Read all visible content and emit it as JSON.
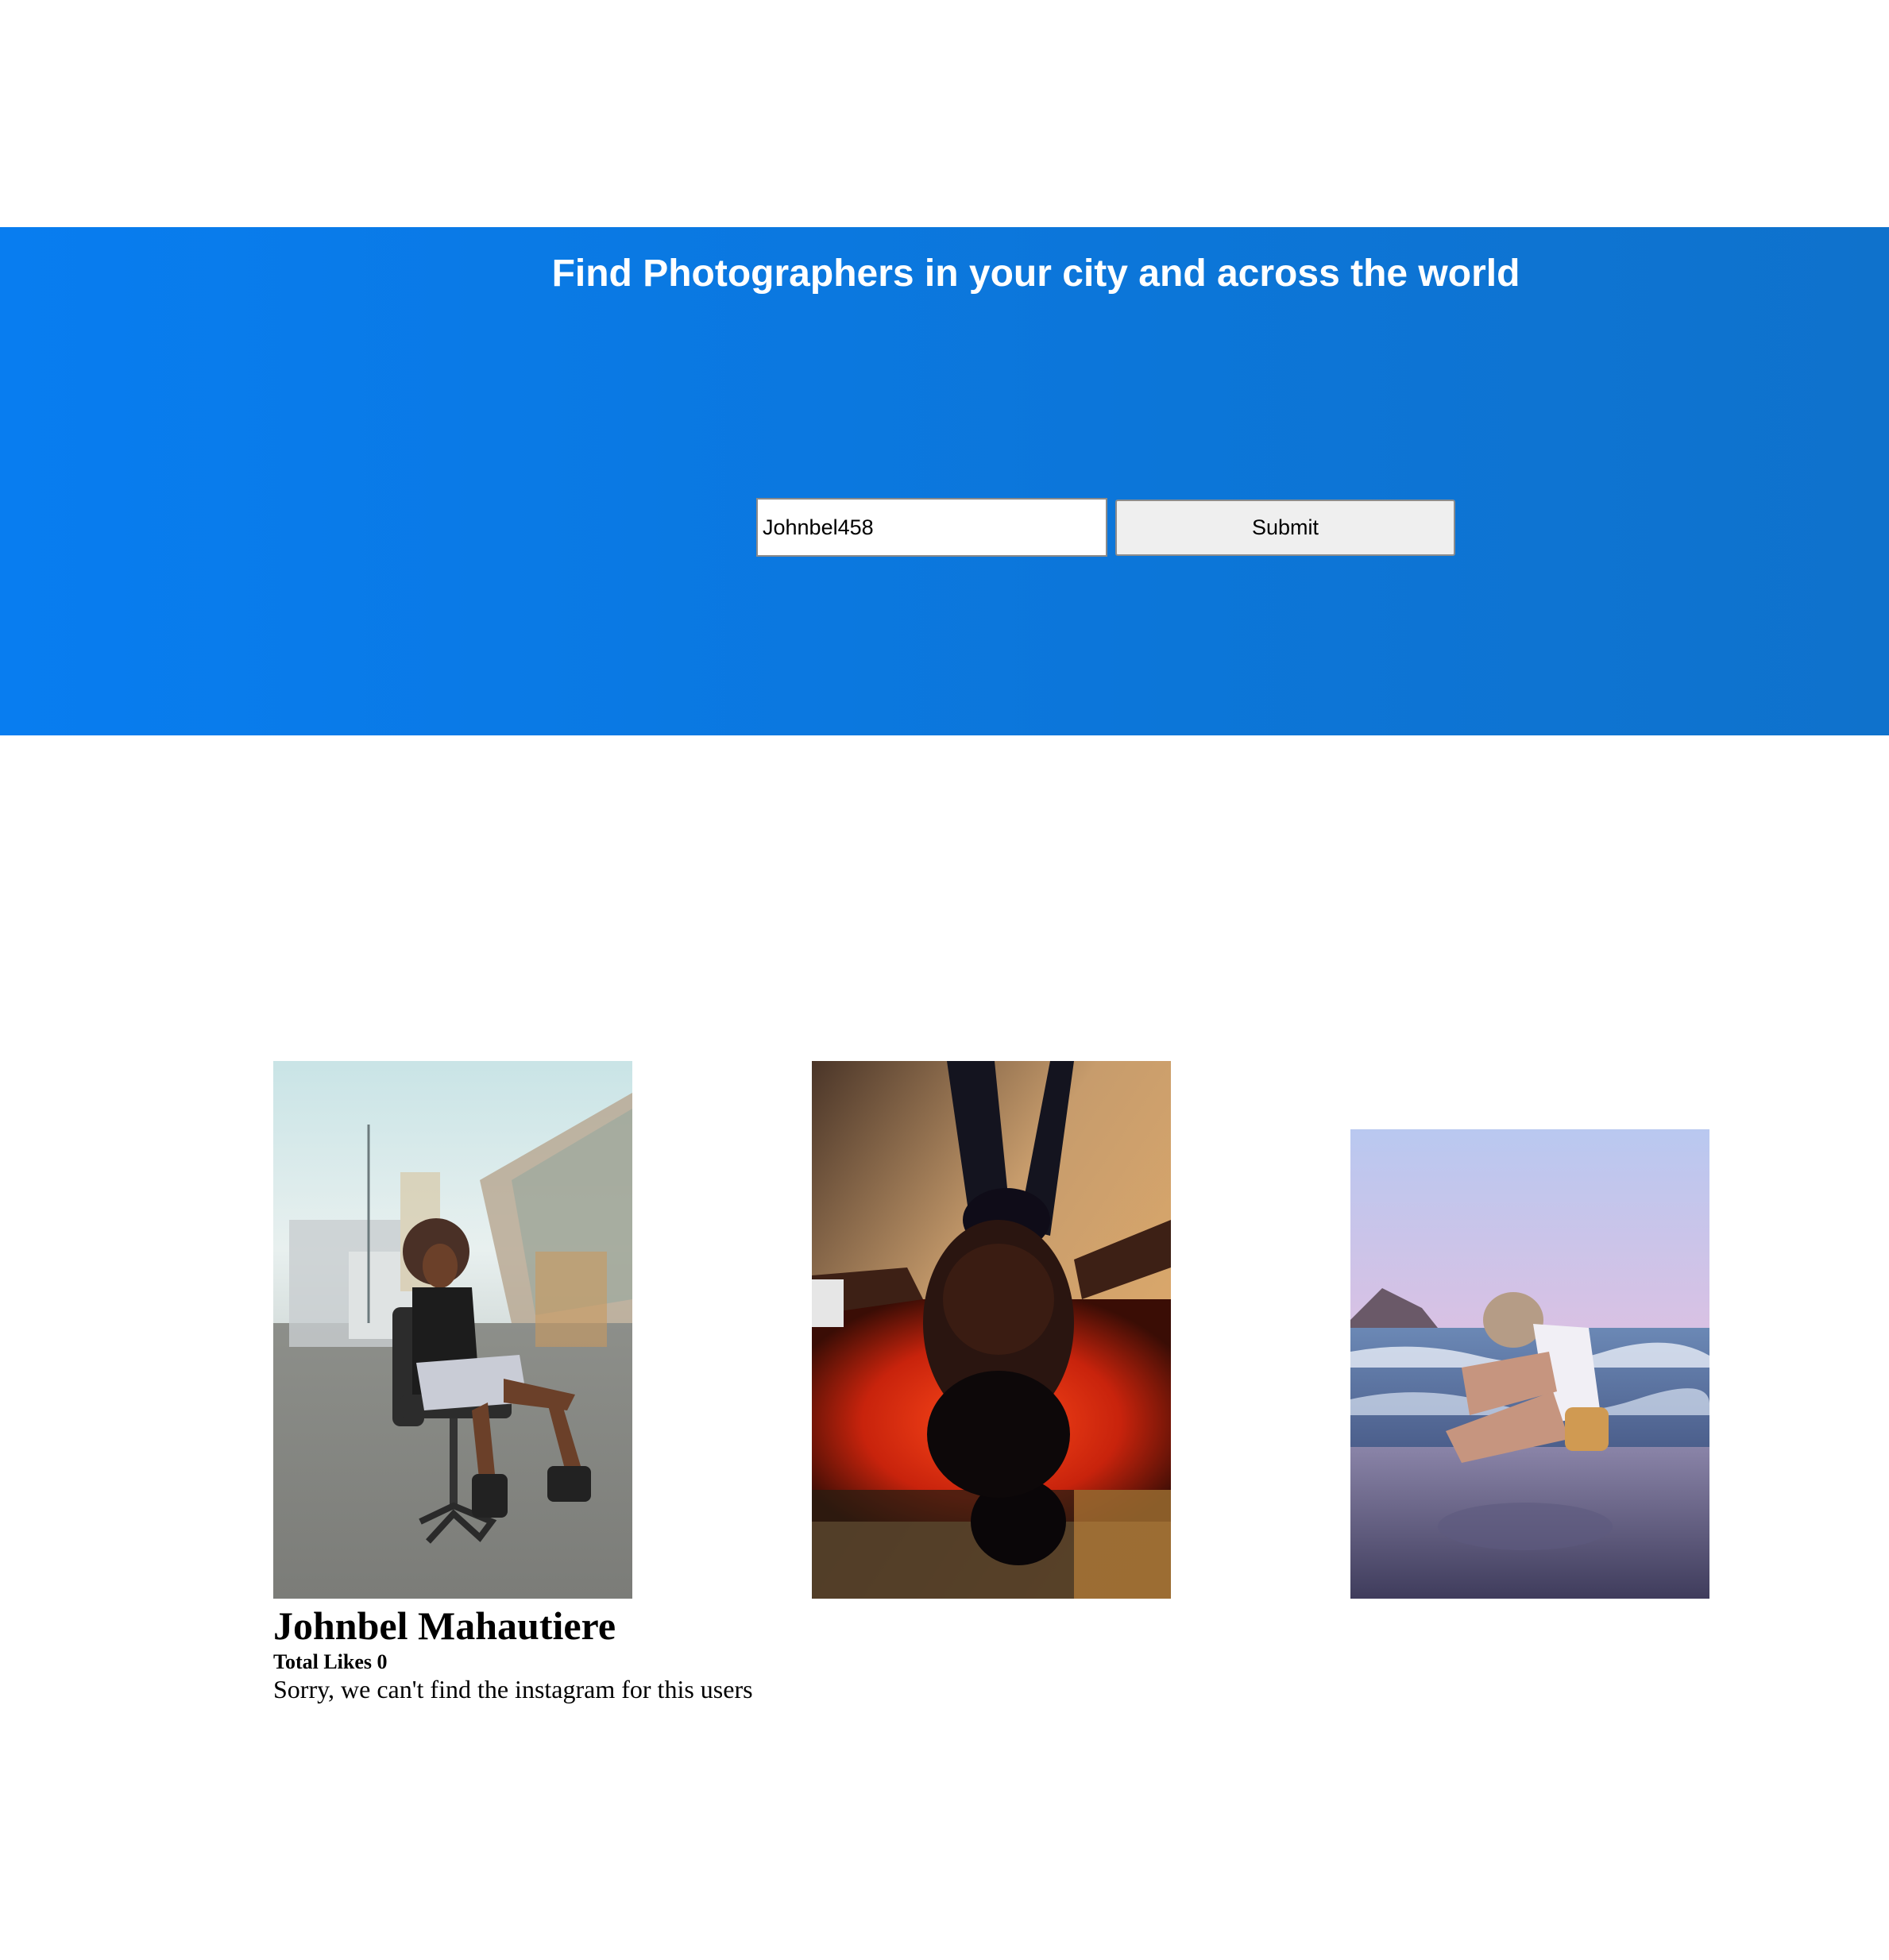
{
  "hero": {
    "title": "Find Photographers in your city and across the world",
    "search_value": "Johnbel458",
    "submit_label": "Submit",
    "background_color": "#087df0"
  },
  "photos": [
    {
      "label": "street-portrait-photo"
    },
    {
      "label": "upside-down-portrait-photo"
    },
    {
      "label": "beach-sitting-photo"
    }
  ],
  "profile": {
    "name": "Johnbel Mahautiere",
    "likes_label": "Total Likes",
    "likes_count": "0",
    "message": "Sorry, we can't find the instagram for this users"
  }
}
